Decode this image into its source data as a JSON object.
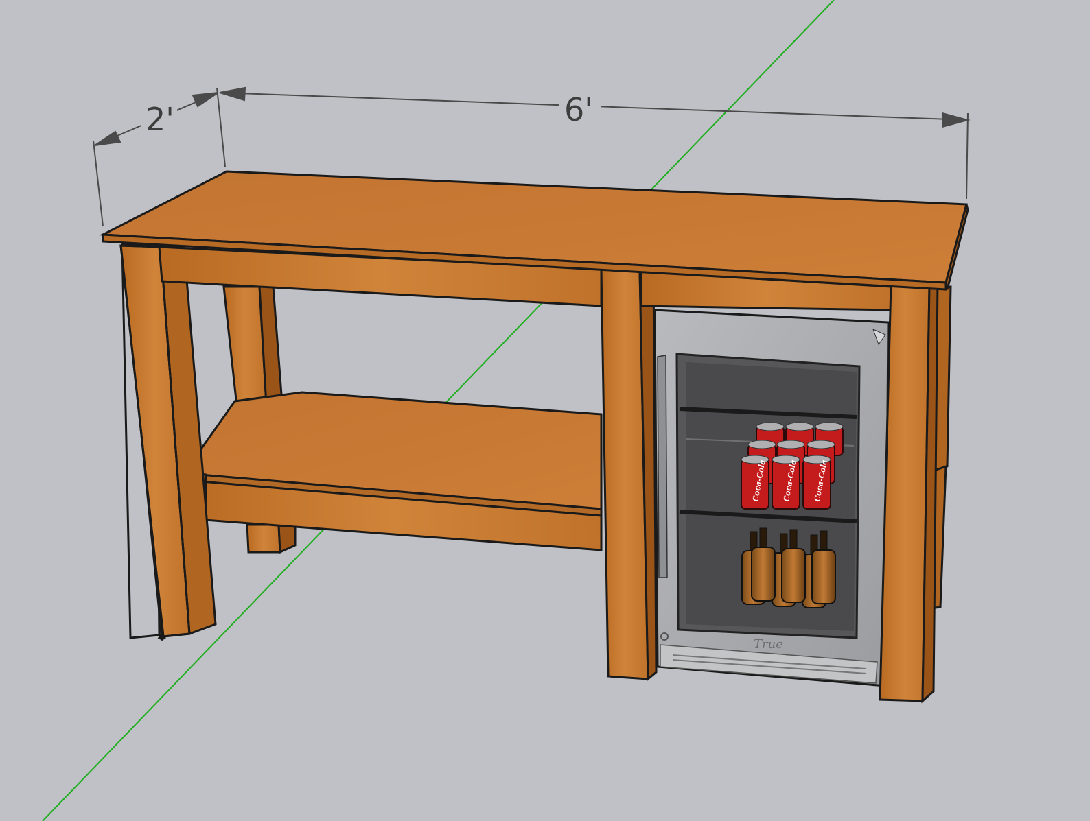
{
  "dimensions": {
    "depth": "2'",
    "width": "6'"
  },
  "fridge": {
    "brand": "True",
    "can_label": "Coca-Cola"
  },
  "colors": {
    "background": "#c0c1c6",
    "wood": "#c9782b",
    "wood_dark": "#a9631f",
    "wood_top": "#c87a35",
    "axis_green": "#1fae1f",
    "dimension_line": "#4a4a4a",
    "fridge_steel": "#a7a8ab",
    "fridge_glass": "#5e5e60",
    "can_red": "#c41c1c"
  }
}
